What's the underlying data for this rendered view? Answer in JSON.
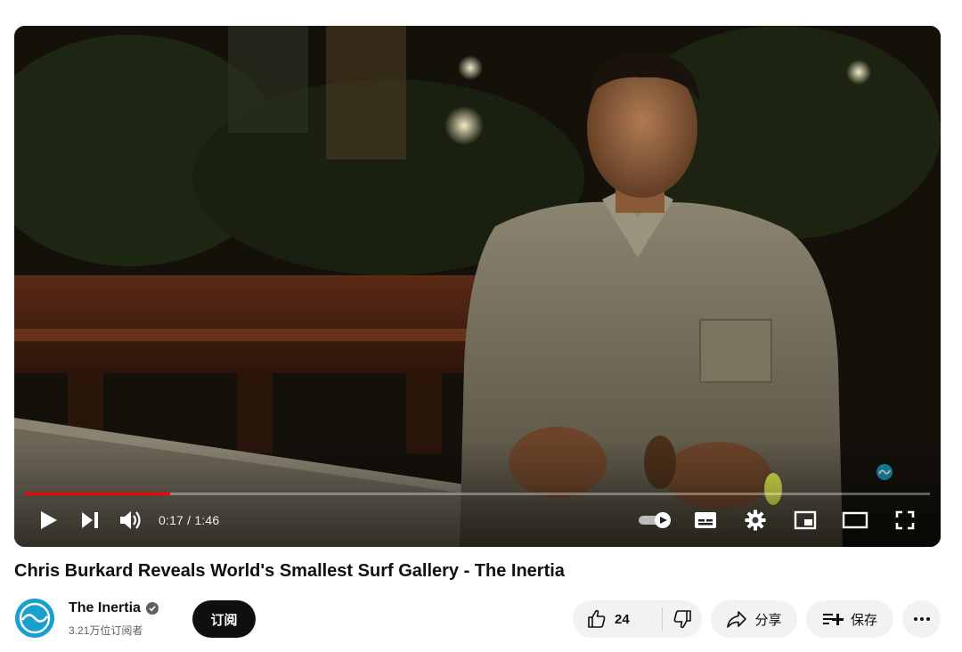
{
  "player": {
    "current_time": "0:17",
    "separator": "/",
    "duration": "1:46",
    "progress_fraction": 0.16,
    "accent_color": "#ff0000",
    "controls": [
      "play-icon",
      "next-icon",
      "volume-icon",
      "autoplay-toggle-icon",
      "subtitles-icon",
      "settings-icon",
      "miniplayer-icon",
      "theater-mode-icon",
      "fullscreen-icon"
    ]
  },
  "video": {
    "title": "Chris Burkard Reveals World's Smallest Surf Gallery - The Inertia"
  },
  "channel": {
    "name": "The Inertia",
    "subscribers": "3.21万位订阅者",
    "subscribe_label": "订阅",
    "avatar_color": "#1a9fd1"
  },
  "actions": {
    "like_count": "24",
    "share_label": "分享",
    "save_label": "保存",
    "more_icon": "more-horizontal-icon"
  }
}
